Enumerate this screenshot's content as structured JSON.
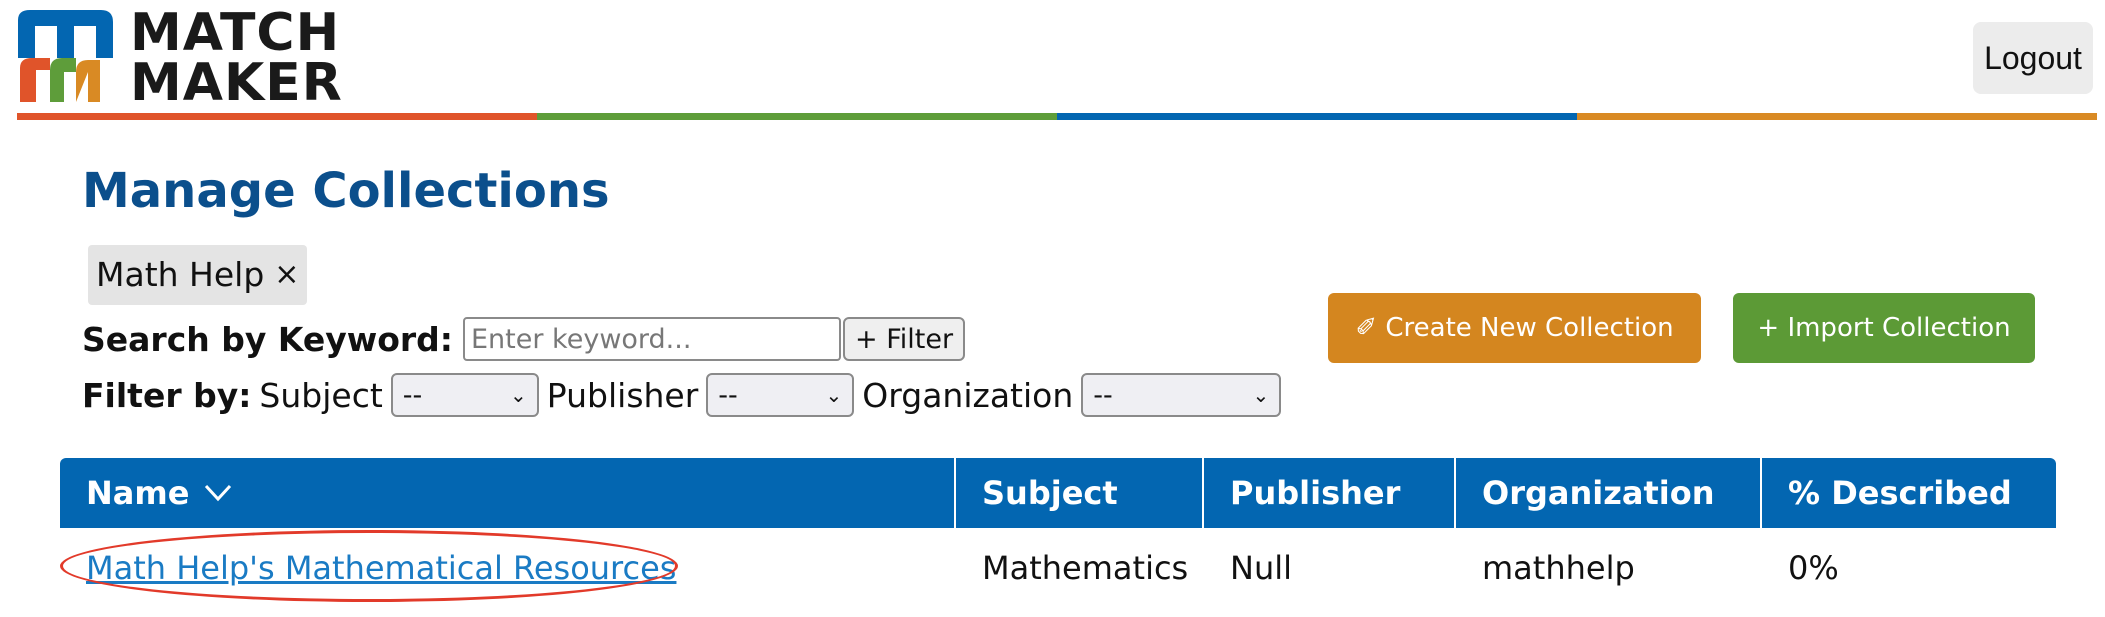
{
  "header": {
    "logo_line1": "MATCH",
    "logo_line2": "MAKER",
    "logout_label": "Logout",
    "color_bar": [
      "#e0542a",
      "#5e9d3a",
      "#0366b1",
      "#d98a24"
    ]
  },
  "page_title": "Manage Collections",
  "active_filter_chip": {
    "label": "Math Help",
    "close": "×"
  },
  "search": {
    "label": "Search by Keyword:",
    "placeholder": "Enter keyword...",
    "filter_button": "+ Filter"
  },
  "filters": {
    "label": "Filter by:",
    "subject_label": "Subject",
    "subject_value": "--",
    "publisher_label": "Publisher",
    "publisher_value": "--",
    "organization_label": "Organization",
    "organization_value": "--"
  },
  "actions": {
    "create_label": "✐ Create New Collection",
    "import_label": "+ Import Collection",
    "create_color": "#d4861f",
    "import_color": "#5c9a36"
  },
  "table": {
    "columns": [
      "Name",
      "Subject",
      "Publisher",
      "Organization",
      "% Described"
    ],
    "sort_icon": "chevron-down-icon",
    "rows": [
      {
        "name": "Math Help's Mathematical Resources",
        "subject": "Mathematics",
        "publisher": "Null",
        "organization": "mathhelp",
        "described": "0%"
      }
    ]
  }
}
